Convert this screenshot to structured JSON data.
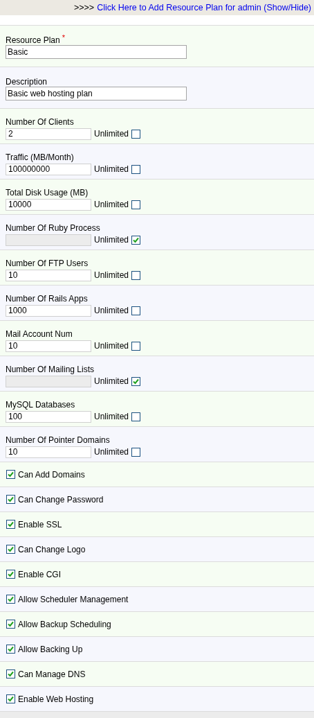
{
  "header": {
    "prefix": ">>>>",
    "link": "Click Here to Add Resource Plan for admin (Show/Hide)"
  },
  "fields": [
    {
      "kind": "text",
      "label": "Resource Plan",
      "required_mark": "*",
      "value": "Basic"
    },
    {
      "kind": "text",
      "label": "Description",
      "value": "Basic web hosting plan"
    },
    {
      "kind": "limit",
      "label": "Number Of Clients",
      "value": "2",
      "unlimited_label": "Unlimited",
      "unlimited": false
    },
    {
      "kind": "limit",
      "label": "Traffic (MB/Month)",
      "value": "100000000",
      "unlimited_label": "Unlimited",
      "unlimited": false
    },
    {
      "kind": "limit",
      "label": "Total Disk Usage (MB)",
      "value": "10000",
      "unlimited_label": "Unlimited",
      "unlimited": false
    },
    {
      "kind": "limit",
      "label": "Number Of Ruby Process",
      "unlimited_label": "Unlimited",
      "unlimited": true
    },
    {
      "kind": "limit",
      "label": "Number Of FTP Users",
      "value": "10",
      "unlimited_label": "Unlimited",
      "unlimited": false
    },
    {
      "kind": "limit",
      "label": "Number Of Rails Apps",
      "value": "1000",
      "unlimited_label": "Unlimited",
      "unlimited": false
    },
    {
      "kind": "limit",
      "label": "Mail Account Num",
      "value": "10",
      "unlimited_label": "Unlimited",
      "unlimited": false
    },
    {
      "kind": "limit",
      "label": "Number Of Mailing Lists",
      "unlimited_label": "Unlimited",
      "unlimited": true
    },
    {
      "kind": "limit",
      "label": "MySQL Databases",
      "value": "100",
      "unlimited_label": "Unlimited",
      "unlimited": false
    },
    {
      "kind": "limit",
      "label": "Number Of Pointer Domains",
      "value": "10",
      "unlimited_label": "Unlimited",
      "unlimited": false
    },
    {
      "kind": "check",
      "label": "Can Add Domains",
      "checked": true
    },
    {
      "kind": "check",
      "label": "Can Change Password",
      "checked": true
    },
    {
      "kind": "check",
      "label": "Enable SSL",
      "checked": true
    },
    {
      "kind": "check",
      "label": "Can Change Logo",
      "checked": true
    },
    {
      "kind": "check",
      "label": "Enable CGI",
      "checked": true
    },
    {
      "kind": "check",
      "label": "Allow Scheduler Management",
      "checked": true
    },
    {
      "kind": "check",
      "label": "Allow Backup Scheduling",
      "checked": true
    },
    {
      "kind": "check",
      "label": "Allow Backing Up",
      "checked": true
    },
    {
      "kind": "check",
      "label": "Can Manage DNS",
      "checked": true
    },
    {
      "kind": "check",
      "label": "Enable Web Hosting",
      "checked": true
    }
  ]
}
